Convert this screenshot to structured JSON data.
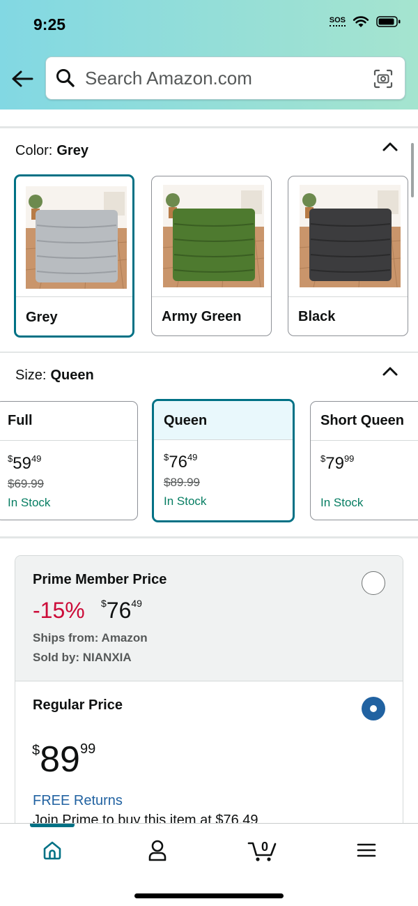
{
  "status": {
    "time": "9:25",
    "sos": "SOS"
  },
  "search": {
    "placeholder": "Search Amazon.com"
  },
  "color_section": {
    "label": "Color:",
    "value": "Grey",
    "options": [
      {
        "label": "Grey",
        "swatch": "#b8bcc0",
        "selected": true
      },
      {
        "label": "Army Green",
        "swatch": "#4e7a2f",
        "selected": false
      },
      {
        "label": "Black",
        "swatch": "#3c3c3e",
        "selected": false
      }
    ]
  },
  "size_section": {
    "label": "Size:",
    "value": "Queen",
    "options": [
      {
        "name": "Full",
        "price_whole": "59",
        "price_fraction": "49",
        "currency": "$",
        "was": "$69.99",
        "stock": "In Stock",
        "selected": false
      },
      {
        "name": "Queen",
        "price_whole": "76",
        "price_fraction": "49",
        "currency": "$",
        "was": "$89.99",
        "stock": "In Stock",
        "selected": true
      },
      {
        "name": "Short Queen",
        "price_whole": "79",
        "price_fraction": "99",
        "currency": "$",
        "was": "",
        "stock": "In Stock",
        "selected": false
      }
    ]
  },
  "offers": {
    "prime": {
      "title": "Prime Member Price",
      "discount": "-15%",
      "currency": "$",
      "price_whole": "76",
      "price_fraction": "49",
      "ships_from": "Ships from: Amazon",
      "sold_by": "Sold by: NIANXIA",
      "selected": false
    },
    "regular": {
      "title": "Regular Price",
      "currency": "$",
      "price_whole": "89",
      "price_fraction": "99",
      "returns": "FREE Returns",
      "join_prime": "Join Prime to buy this item at $76.49",
      "selected": true
    }
  },
  "bottom_nav": {
    "cart_count": "0"
  },
  "colors": {
    "accent": "#007185",
    "discount": "#cc0c39",
    "link": "#2162a1",
    "stock": "#067d62"
  }
}
